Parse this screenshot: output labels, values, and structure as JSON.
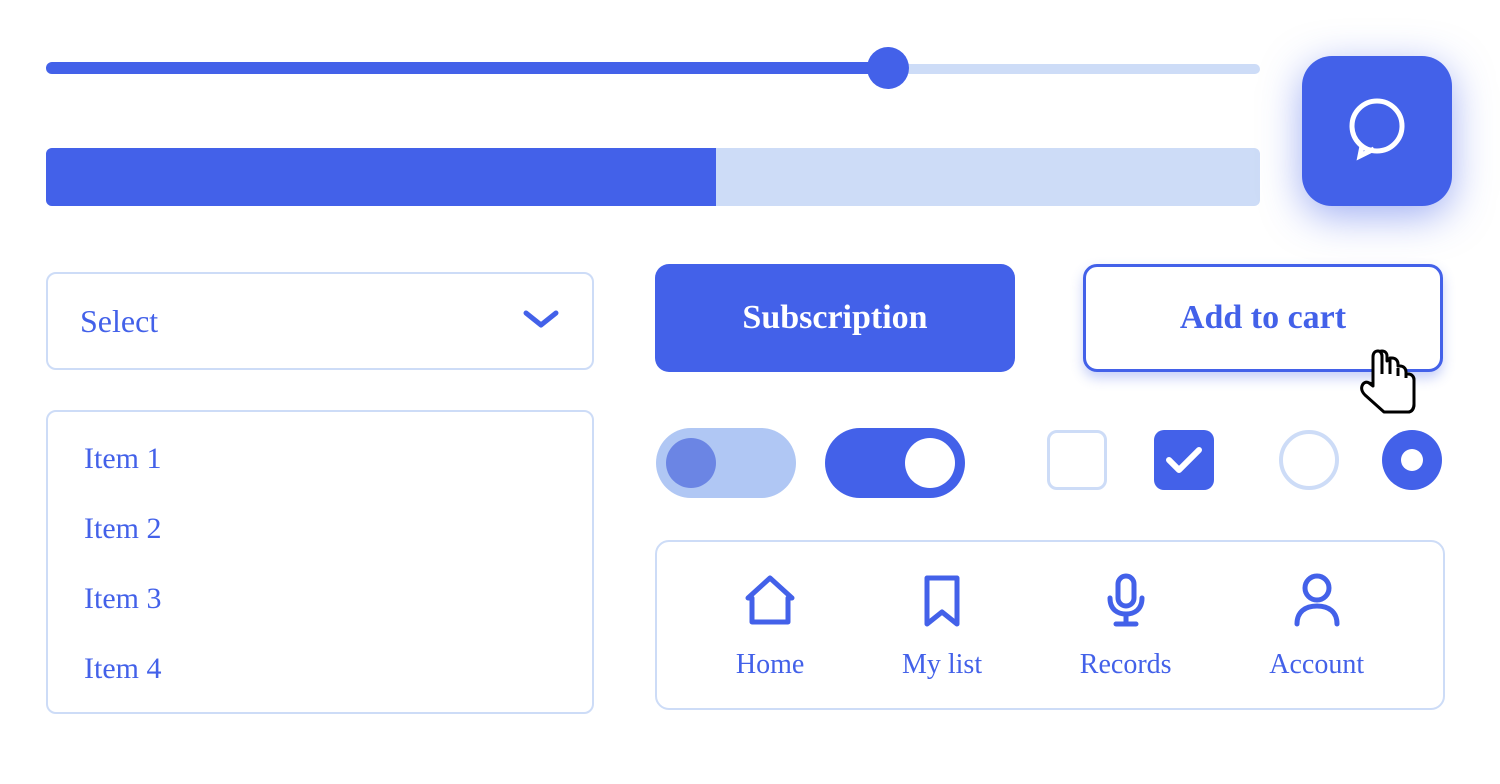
{
  "colors": {
    "primary": "#4361e9",
    "primary_light": "#cddcf7",
    "toggle_off_bg": "#b0c7f4",
    "toggle_off_thumb": "#6b85e4",
    "white": "#ffffff"
  },
  "slider": {
    "value_percent": 69
  },
  "progress": {
    "value_percent": 55
  },
  "select": {
    "label": "Select"
  },
  "items": [
    "Item 1",
    "Item 2",
    "Item 3",
    "Item 4"
  ],
  "buttons": {
    "subscription": "Subscription",
    "add_to_cart": "Add to cart"
  },
  "toggles": {
    "toggle1": false,
    "toggle2": true
  },
  "checkboxes": {
    "checkbox1": false,
    "checkbox2": true
  },
  "radios": {
    "radio1": false,
    "radio2": true
  },
  "nav": {
    "items": [
      {
        "label": "Home",
        "icon": "home-icon"
      },
      {
        "label": "My list",
        "icon": "bookmark-icon"
      },
      {
        "label": "Records",
        "icon": "microphone-icon"
      },
      {
        "label": "Account",
        "icon": "user-icon"
      }
    ]
  }
}
